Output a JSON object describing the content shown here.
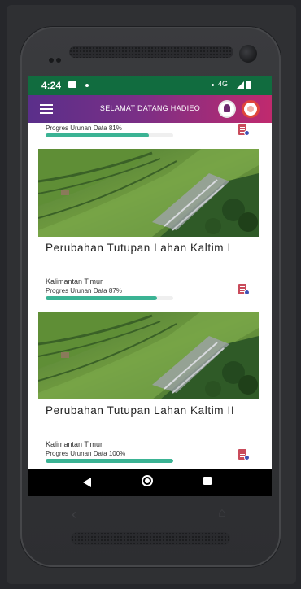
{
  "status_bar": {
    "time": "4:24",
    "network": "4G"
  },
  "app_bar": {
    "title": "SELAMAT DATANG HADIEO"
  },
  "previous_item": {
    "progress_label": "Progres Urunan Data 81%",
    "progress_percent": 81
  },
  "cards": [
    {
      "title": "Perubahan Tutupan Lahan Kaltim I",
      "location": "Kalimantan Timur",
      "progress_label": "Progres Urunan Data 87%",
      "progress_percent": 87
    },
    {
      "title": "Perubahan Tutupan Lahan Kaltim II",
      "location": "Kalimantan Timur",
      "progress_label": "Progres Urunan Data 100%",
      "progress_percent": 100
    }
  ],
  "icons": {
    "menu": "hamburger-menu-icon",
    "notification": "bell-icon",
    "profile": "avatar-icon",
    "task": "document-clock-icon",
    "nav_back": "triangle-back-icon",
    "nav_home": "circle-home-icon",
    "nav_recent": "square-recent-icon"
  },
  "colors": {
    "status_bar": "#116c3f",
    "app_bar_start": "#5a2f8a",
    "app_bar_end": "#c02a6e",
    "progress": "#3bb394"
  }
}
